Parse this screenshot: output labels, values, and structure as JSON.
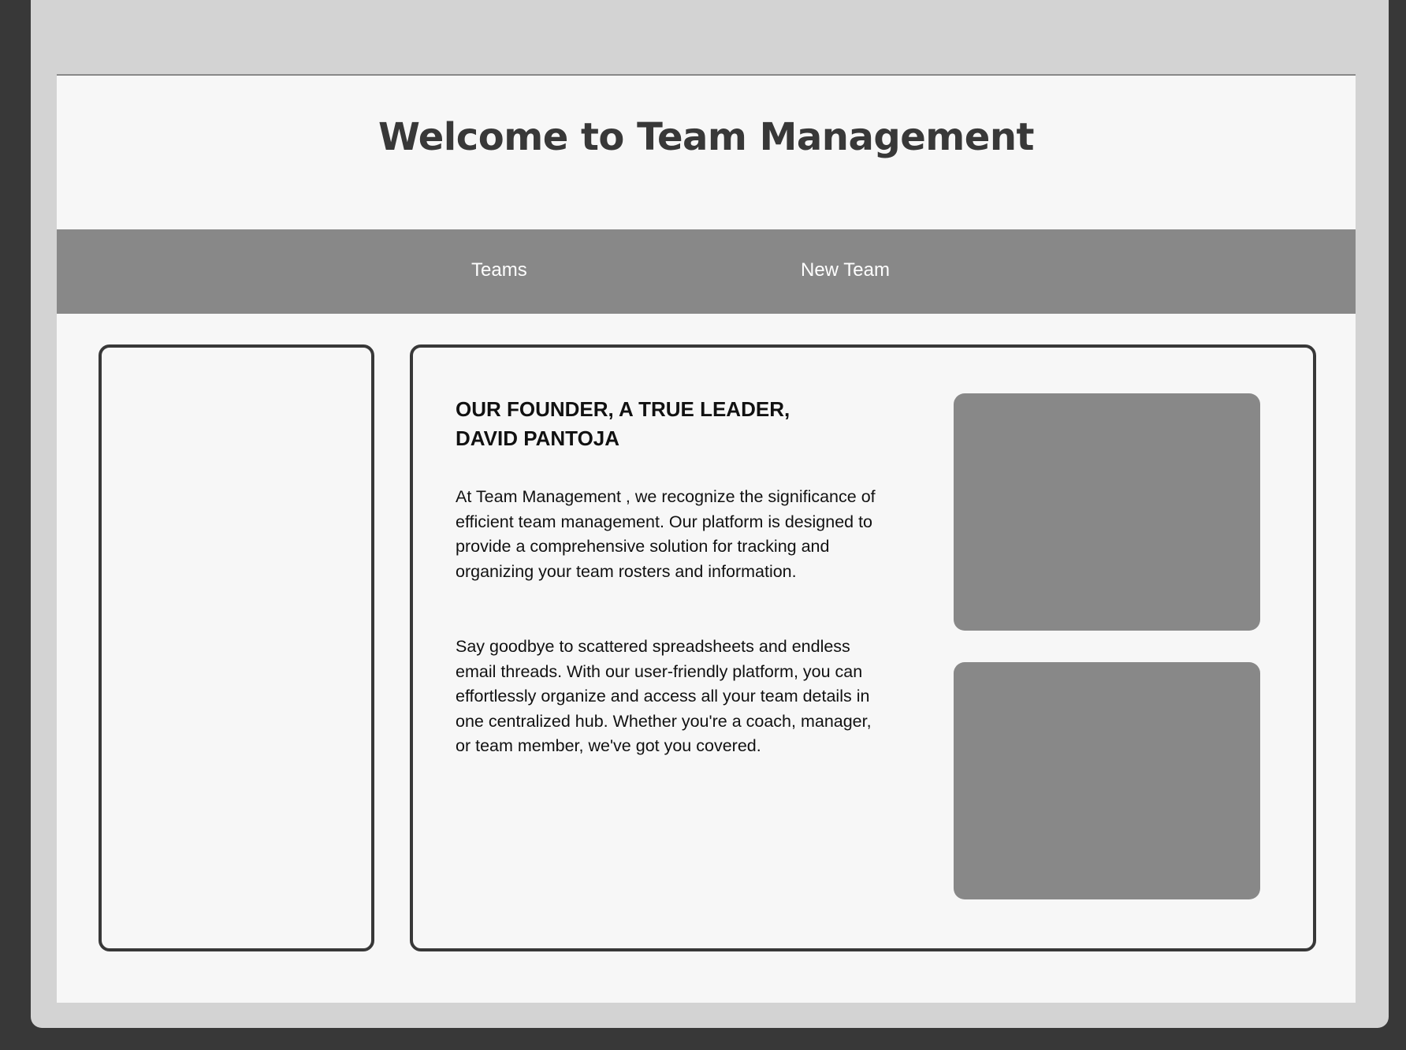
{
  "header": {
    "title": "Welcome to Team Management"
  },
  "nav": {
    "items": [
      {
        "label": "Teams"
      },
      {
        "label": "New Team"
      }
    ]
  },
  "content": {
    "heading_line1": "OUR FOUNDER, A TRUE LEADER,",
    "heading_line2": "DAVID PANTOJA",
    "paragraph1": "At Team Management , we recognize the significance of efficient team management. Our platform is designed to provide a comprehensive solution for tracking and organizing your team rosters and information.",
    "paragraph2": "Say goodbye to scattered spreadsheets and endless email threads. With our user-friendly platform, you can effortlessly organize and access all your team details in one centralized hub. Whether you're a coach, manager, or team member, we've got you covered."
  },
  "colors": {
    "background": "#383838",
    "frame": "#d3d3d3",
    "page": "#f7f7f7",
    "nav_bar": "#888888",
    "text_dark": "#383838",
    "placeholder": "#888888"
  }
}
